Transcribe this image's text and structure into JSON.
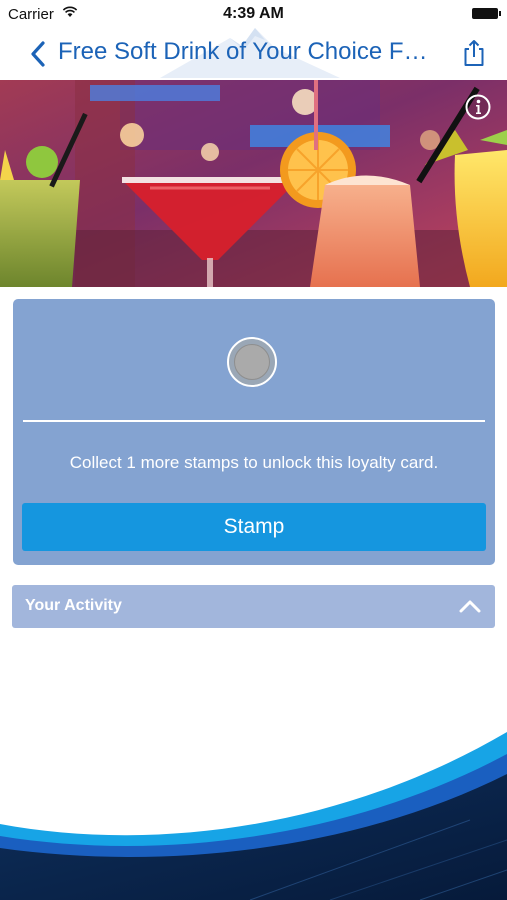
{
  "status_bar": {
    "carrier": "Carrier",
    "time": "4:39 AM"
  },
  "nav": {
    "title": "Free Soft Drink of Your Choice F…",
    "back_icon": "chevron-left-icon",
    "share_icon": "share-icon",
    "accent": "#1c63b7"
  },
  "hero": {
    "info_icon": "info-icon"
  },
  "stamp_card": {
    "collected": 0,
    "total": 1,
    "message": "Collect 1 more stamps to unlock this loyalty card.",
    "button_label": "Stamp",
    "card_color": "#84a3d1",
    "button_color": "#1596df"
  },
  "activity": {
    "title": "Your Activity",
    "toggle_icon": "chevron-up-icon"
  }
}
